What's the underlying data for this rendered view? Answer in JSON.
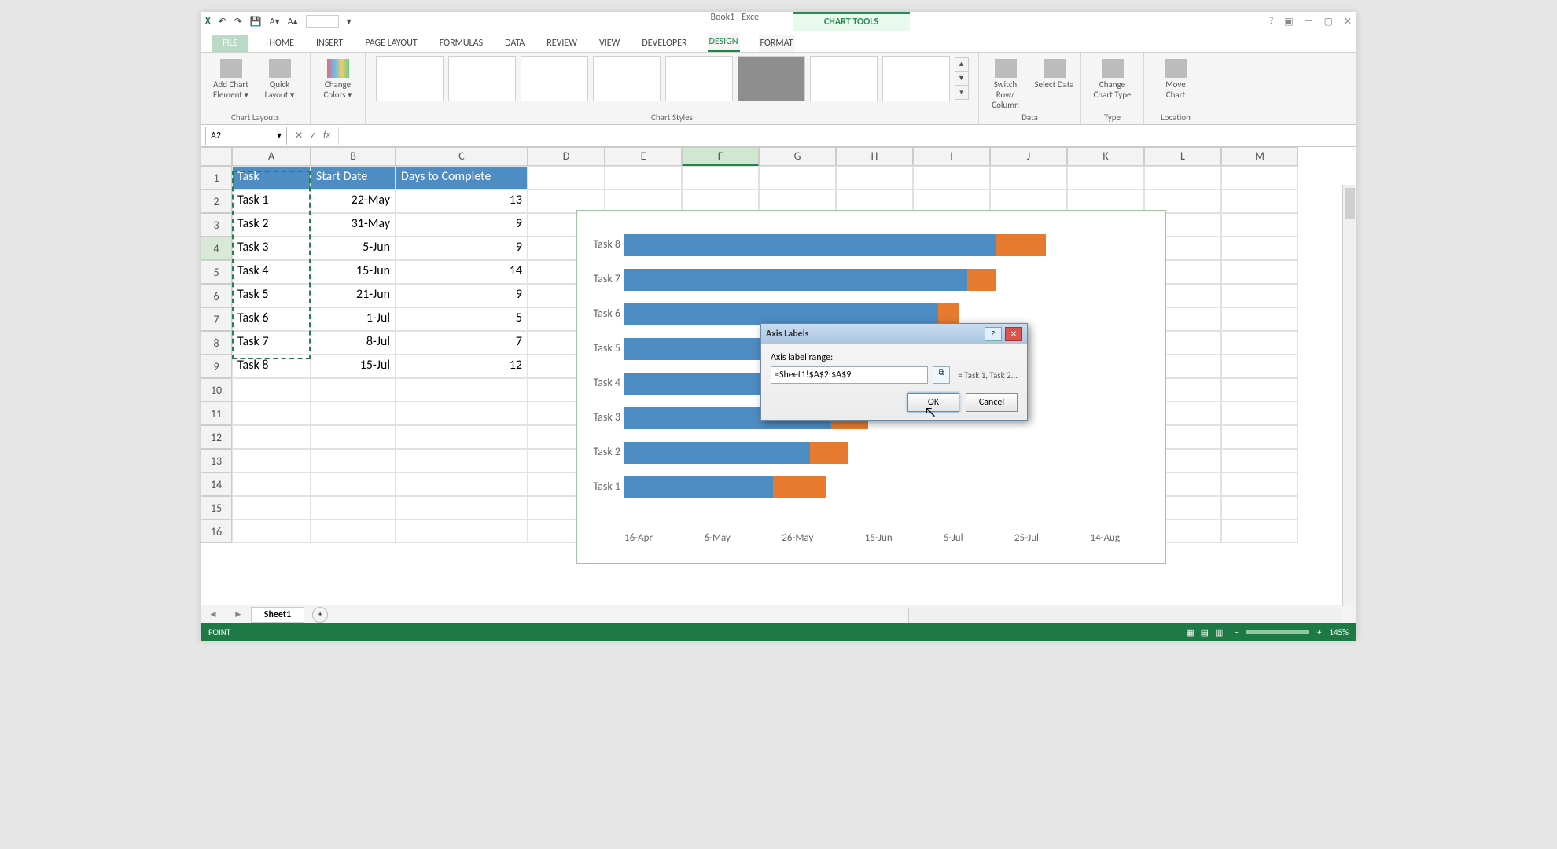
{
  "titlebar": {
    "doc_title": "Book1 - Excel",
    "tools_label": "CHART TOOLS"
  },
  "tabs": {
    "file": "FILE",
    "home": "HOME",
    "insert": "INSERT",
    "pagelayout": "PAGE LAYOUT",
    "formulas": "FORMULAS",
    "data": "DATA",
    "review": "REVIEW",
    "view": "VIEW",
    "developer": "DEVELOPER",
    "design": "DESIGN",
    "format": "FORMAT"
  },
  "ribbon": {
    "add_chart_el": "Add Chart Element ▾",
    "quick_layout": "Quick Layout ▾",
    "change_colors": "Change Colors ▾",
    "switch_rc": "Switch Row/ Column",
    "select_data": "Select Data",
    "change_type": "Change Chart Type",
    "move_chart": "Move Chart",
    "g_chartlayouts": "Chart Layouts",
    "g_chartstyles": "Chart Styles",
    "g_data": "Data",
    "g_type": "Type",
    "g_location": "Location"
  },
  "namebox": "A2",
  "fx": "fx",
  "columns": [
    "A",
    "B",
    "C",
    "D",
    "E",
    "F",
    "G",
    "H",
    "I",
    "J",
    "K",
    "L",
    "M"
  ],
  "col_widths": {
    "A": 100,
    "B": 108,
    "C": 168
  },
  "table": {
    "headers": {
      "task": "Task",
      "start": "Start Date",
      "days": "Days to Complete"
    },
    "rows": [
      {
        "task": "Task 1",
        "start": "22-May",
        "days": "13"
      },
      {
        "task": "Task 2",
        "start": "31-May",
        "days": "9"
      },
      {
        "task": "Task 3",
        "start": "5-Jun",
        "days": "9"
      },
      {
        "task": "Task 4",
        "start": "15-Jun",
        "days": "14"
      },
      {
        "task": "Task 5",
        "start": "21-Jun",
        "days": "9"
      },
      {
        "task": "Task 6",
        "start": "1-Jul",
        "days": "5"
      },
      {
        "task": "Task 7",
        "start": "8-Jul",
        "days": "7"
      },
      {
        "task": "Task 8",
        "start": "15-Jul",
        "days": "12"
      }
    ]
  },
  "row_numbers": [
    "1",
    "2",
    "3",
    "4",
    "5",
    "6",
    "7",
    "8",
    "9",
    "10",
    "11",
    "12",
    "13",
    "14",
    "15",
    "16"
  ],
  "sheet": {
    "name": "Sheet1"
  },
  "status": {
    "mode": "POINT",
    "zoom": "145%"
  },
  "dialog": {
    "title": "Axis Labels",
    "label": "Axis label range:",
    "value": "=Sheet1!$A$2:$A$9",
    "preview": "= Task 1, Task 2...",
    "ok": "OK",
    "cancel": "Cancel"
  },
  "chart_data": {
    "type": "bar",
    "title": "",
    "xlabel": "",
    "ylabel": "",
    "x_ticks": [
      "16-Apr",
      "6-May",
      "26-May",
      "15-Jun",
      "5-Jul",
      "25-Jul",
      "14-Aug"
    ],
    "categories": [
      "Task 1",
      "Task 2",
      "Task 3",
      "Task 4",
      "Task 5",
      "Task 6",
      "Task 7",
      "Task 8"
    ],
    "display_order": [
      "Task 8",
      "Task 7",
      "Task 6",
      "Task 5",
      "Task 4",
      "Task 3",
      "Task 2",
      "Task 1"
    ],
    "series": [
      {
        "name": "Start Date",
        "values_label": [
          "22-May",
          "31-May",
          "5-Jun",
          "15-Jun",
          "21-Jun",
          "1-Jul",
          "8-Jul",
          "15-Jul"
        ],
        "values_offset_days": [
          36,
          45,
          50,
          60,
          66,
          76,
          83,
          90
        ]
      },
      {
        "name": "Days to Complete",
        "values": [
          13,
          9,
          9,
          14,
          9,
          5,
          7,
          12
        ]
      }
    ],
    "x_origin_label": "16-Apr",
    "x_range_days": 120
  }
}
